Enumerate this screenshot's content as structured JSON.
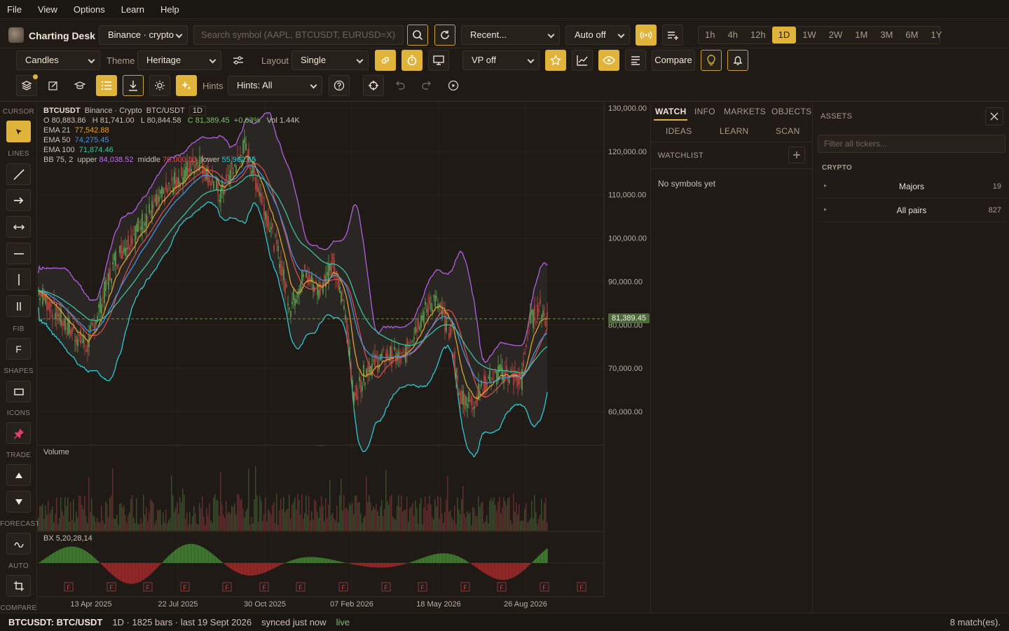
{
  "menu": [
    "File",
    "View",
    "Options",
    "Learn",
    "Help"
  ],
  "app": {
    "title": "Charting Desk"
  },
  "toolbar1": {
    "exchange": "Binance · crypto",
    "search_placeholder": "Search symbol (AAPL, BTCUSDT, EURUSD=X)",
    "recent": "Recent...",
    "auto": "Auto off",
    "timeframes": [
      "1h",
      "4h",
      "12h",
      "1D",
      "1W",
      "2W",
      "1M",
      "3M",
      "6M",
      "1Y"
    ],
    "active_tf": "1D"
  },
  "toolbar2": {
    "chart_type": "Candles",
    "theme_label": "Theme",
    "theme": "Heritage",
    "layout_label": "Layout",
    "layout": "Single",
    "vp": "VP off",
    "compare": "Compare"
  },
  "toolbar3": {
    "hints_label": "Hints",
    "hints": "Hints: All"
  },
  "leftbar": {
    "sections": [
      "CURSOR",
      "LINES",
      "FIB",
      "SHAPES",
      "ICONS",
      "TRADE",
      "FORECAST",
      "AUTO",
      "COMPARE"
    ],
    "fib_glyph": "F"
  },
  "chart": {
    "symbol": "BTCUSDT",
    "source": "Binance · Crypto",
    "pair": "BTC/USDT",
    "interval": "1D",
    "ohlc": {
      "o": "O 80,883.86",
      "h": "H 81,741.00",
      "l": "L 80,844.58",
      "c": "C 81,389.45",
      "chg": "+0.63%",
      "vol": "Vol 1.44K"
    },
    "ema21": {
      "label": "EMA 21",
      "value": "77,542.88"
    },
    "ema50": {
      "label": "EMA 50",
      "value": "74,275.45"
    },
    "ema100": {
      "label": "EMA 100",
      "value": "71,874.46"
    },
    "bb": {
      "label": "BB 75, 2",
      "upper_label": "upper",
      "upper": "84,038.52",
      "middle_label": "middle",
      "middle": "70,000.53",
      "lower_label": "lower",
      "lower": "55,962.65"
    },
    "price_ticks": [
      "130,000.00",
      "120,000.00",
      "110,000.00",
      "100,000.00",
      "90,000.00",
      "80,000.00",
      "70,000.00",
      "60,000.00"
    ],
    "last_price": "81,389.45",
    "volume_label": "Volume",
    "osc_label": "BX 5,20,28,14",
    "date_ticks": [
      "13 Apr 2025",
      "22 Jul 2025",
      "30 Oct 2025",
      "07 Feb 2026",
      "18 May 2026",
      "26 Aug 2026"
    ],
    "marker": "F",
    "colors": {
      "up": "#5fa04f",
      "down": "#c0453f",
      "ema21": "#e0a030",
      "ema50": "#4a90e0",
      "ema100": "#3cc0a0",
      "bb_upper": "#b060e0",
      "bb_lower": "#30c8d0",
      "bb_mid": "#e05050"
    }
  },
  "panel": {
    "tabs": [
      "WATCH",
      "INFO",
      "MARKETS",
      "OBJECTS"
    ],
    "tabs2": [
      "IDEAS",
      "LEARN",
      "SCAN"
    ],
    "watchlist": "WATCHLIST",
    "empty": "No symbols yet"
  },
  "assets": {
    "title": "ASSETS",
    "filter_placeholder": "Filter all tickers...",
    "group": "CRYPTO",
    "rows": [
      {
        "name": "Majors",
        "count": "19"
      },
      {
        "name": "All pairs",
        "count": "827"
      }
    ]
  },
  "status": {
    "symbol": "BTCUSDT: BTC/USDT",
    "info": "1D · 1825 bars · last 19 Sept 2026",
    "synced": "synced just now",
    "live": "live",
    "matches": "8 match(es)."
  }
}
